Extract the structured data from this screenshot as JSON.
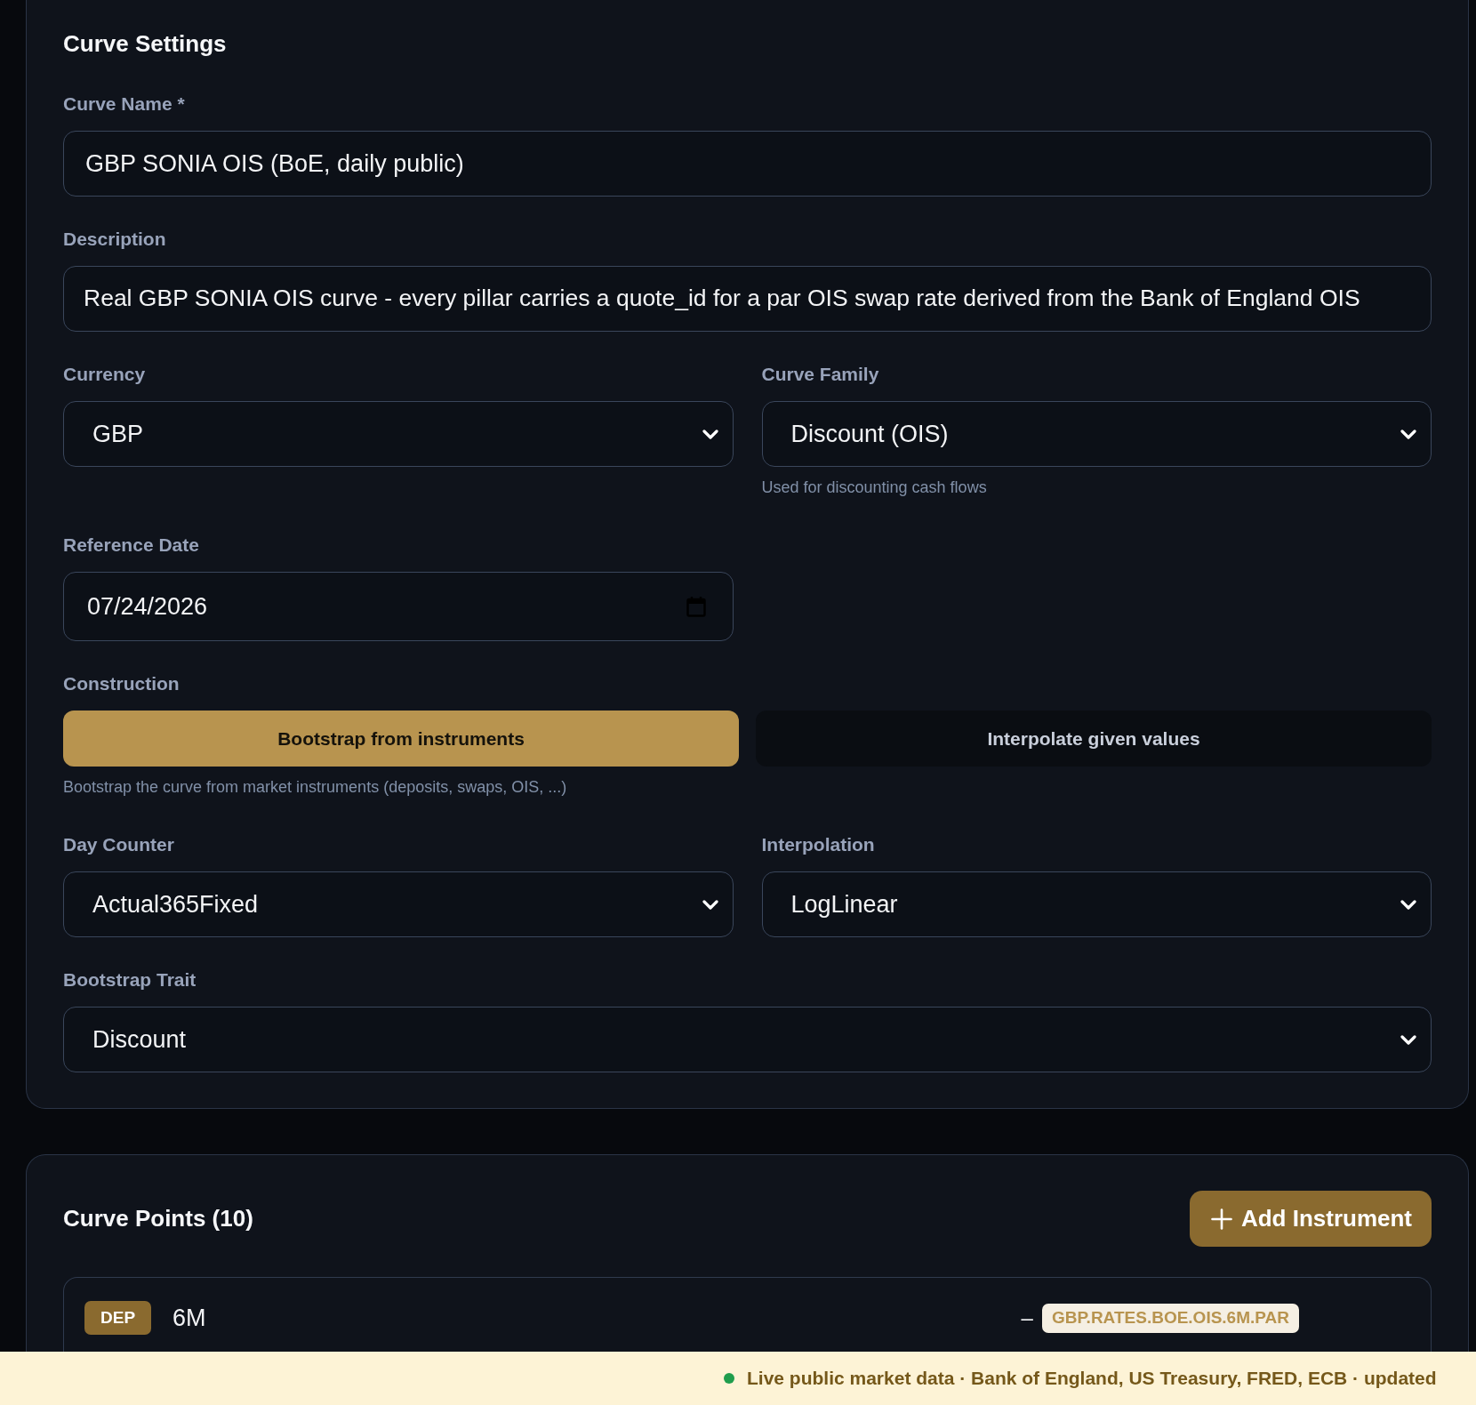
{
  "settings": {
    "title": "Curve Settings",
    "curve_name": {
      "kind": "text",
      "label": "Curve Name *",
      "value": "GBP SONIA OIS (BoE, daily public)"
    },
    "description": {
      "kind": "text",
      "label": "Description",
      "value": "Real GBP SONIA OIS curve - every pillar carries a quote_id for a par OIS swap rate derived from the Bank of England OIS"
    },
    "currency": {
      "kind": "select",
      "label": "Currency",
      "value": "GBP"
    },
    "curve_family": {
      "kind": "select",
      "label": "Curve Family",
      "value": "Discount (OIS)",
      "help": "Used for discounting cash flows"
    },
    "reference_date": {
      "kind": "date",
      "label": "Reference Date",
      "value": "07/24/2026"
    },
    "construction": {
      "label": "Construction",
      "options": [
        {
          "label": "Bootstrap from instruments",
          "selected": true
        },
        {
          "label": "Interpolate given values",
          "selected": false
        }
      ],
      "help": "Bootstrap the curve from market instruments (deposits, swaps, OIS, ...)"
    },
    "day_counter": {
      "kind": "select",
      "label": "Day Counter",
      "value": "Actual365Fixed"
    },
    "interpolation": {
      "kind": "select",
      "label": "Interpolation",
      "value": "LogLinear"
    },
    "bootstrap_trait": {
      "kind": "select",
      "label": "Bootstrap Trait",
      "value": "Discount"
    }
  },
  "curve_points": {
    "title": "Curve Points (10)",
    "add_button": "Add Instrument",
    "items": [
      {
        "type": "DEP",
        "tenor": "6M",
        "value": "–",
        "quote_id": "GBP.RATES.BOE.OIS.6M.PAR"
      }
    ]
  },
  "status_bar": {
    "live": true,
    "text": "Live public market data · Bank of England, US Treasury, FRED, ECB · updated"
  }
}
